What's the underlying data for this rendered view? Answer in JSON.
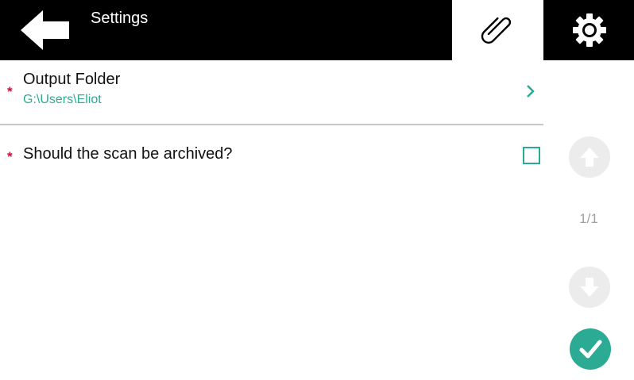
{
  "header": {
    "title": "Settings",
    "back_icon": "arrow-left-icon",
    "tabs": [
      {
        "icon": "paperclip-icon",
        "active": true
      },
      {
        "icon": "gear-icon",
        "active": false
      }
    ]
  },
  "fields": [
    {
      "label": "Output Folder",
      "value": "G:\\Users\\Eliot",
      "required": true,
      "required_mark": "*"
    },
    {
      "label": "Should the scan be archived?",
      "checked": false,
      "required": true,
      "required_mark": "*"
    }
  ],
  "pager": {
    "text": "1/1"
  },
  "colors": {
    "accent": "#2bab94",
    "required": "#d0103a",
    "header_bg": "#000000"
  }
}
